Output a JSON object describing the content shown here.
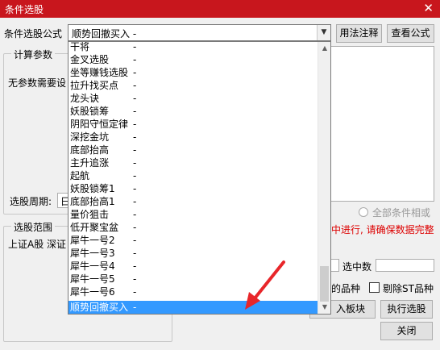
{
  "window": {
    "title": "条件选股",
    "close_glyph": "✕"
  },
  "formula_label": "条件选股公式",
  "formula_combo": {
    "value": "顺势回撤买入 -",
    "arrow_glyph": "▼"
  },
  "buttons": {
    "usage_note": "用法注释",
    "view_formula": "查看公式",
    "add_to_block": "入板块",
    "execute": "执行选股",
    "close": "关闭"
  },
  "calc_params": {
    "title": "计算参数",
    "no_params": "无参数需要设"
  },
  "period": {
    "label": "选股周期:",
    "value": "日"
  },
  "stock_range": {
    "title": "选股范围",
    "items": "上证A股  深证"
  },
  "conditions": {
    "all_conditions": "全部条件相或"
  },
  "notice": {
    "text": "中进行, 请确保数据完整"
  },
  "selected_count_label": "选中数",
  "options": {
    "kind": "的品种",
    "exclude_st": "剔除ST品种"
  },
  "dropdown": {
    "items": [
      {
        "name": "干将",
        "suffix": "-"
      },
      {
        "name": "金叉选股",
        "suffix": "-"
      },
      {
        "name": "坐等赚钱选股",
        "suffix": "-"
      },
      {
        "name": "拉升找买点",
        "suffix": "-"
      },
      {
        "name": "龙头诀",
        "suffix": "-"
      },
      {
        "name": "妖股锁筹",
        "suffix": "-"
      },
      {
        "name": "阴阳守恒定律",
        "suffix": "-"
      },
      {
        "name": "深挖金坑",
        "suffix": "-"
      },
      {
        "name": "底部抬高",
        "suffix": "-"
      },
      {
        "name": "主升追涨",
        "suffix": "-"
      },
      {
        "name": "起航",
        "suffix": "-"
      },
      {
        "name": "妖股锁筹1",
        "suffix": "-"
      },
      {
        "name": "底部抬高1",
        "suffix": "-"
      },
      {
        "name": "量价狙击",
        "suffix": "-"
      },
      {
        "name": "低开聚宝盆",
        "suffix": "-"
      },
      {
        "name": "犀牛一号2",
        "suffix": "-"
      },
      {
        "name": "犀牛一号3",
        "suffix": "-"
      },
      {
        "name": "犀牛一号4",
        "suffix": "-"
      },
      {
        "name": "犀牛一号5",
        "suffix": "-"
      },
      {
        "name": "犀牛一号6",
        "suffix": "-"
      },
      {
        "name": "顺势回撤买入",
        "suffix": "-"
      }
    ],
    "selected_index": 20,
    "scroll_up_glyph": "▲",
    "scroll_down_glyph": "▼"
  },
  "colors": {
    "titlebar": "#c8161d",
    "selection": "#3399ff",
    "notice": "#dd0000",
    "arrow": "#e8262a"
  }
}
